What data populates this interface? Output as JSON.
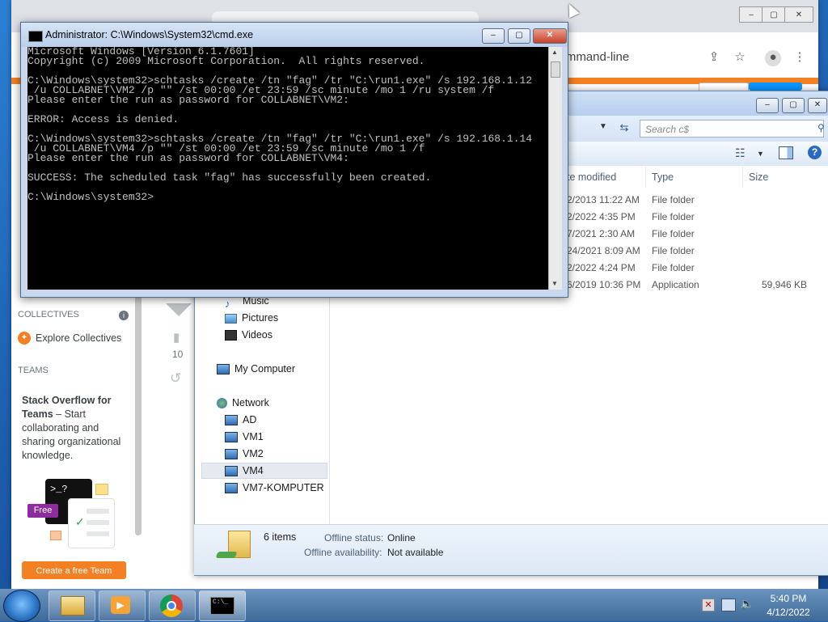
{
  "chrome": {
    "omnibox_text": "command-line",
    "controls": [
      "–",
      "▢",
      "✕"
    ]
  },
  "so": {
    "collectives_label": "COLLECTIVES",
    "explore_collectives": "Explore Collectives",
    "teams_label": "TEAMS",
    "teams_title": "Stack Overflow for Teams",
    "teams_sep": " – ",
    "teams_desc": "Start collaborating and sharing organizational knowledge.",
    "free_badge": "Free",
    "create_team_button": "Create a free Team",
    "vote_count": "10",
    "prompt_glyph": ">_?"
  },
  "explorer": {
    "search_placeholder": "Search c$",
    "columns": {
      "date": "te modified",
      "type": "Type",
      "size": "Size"
    },
    "rows": [
      {
        "date": "2/2013 11:22 AM",
        "type": "File folder",
        "size": ""
      },
      {
        "date": "2/2022 4:35 PM",
        "type": "File folder",
        "size": ""
      },
      {
        "date": "7/2021 2:30 AM",
        "type": "File folder",
        "size": ""
      },
      {
        "date": "24/2021 8:09 AM",
        "type": "File folder",
        "size": ""
      },
      {
        "date": "2/2022 4:24 PM",
        "type": "File folder",
        "size": ""
      },
      {
        "date": "6/2019 10:36 PM",
        "type": "Application",
        "size": "59,946 KB"
      }
    ],
    "nav": {
      "music": "Music",
      "pictures": "Pictures",
      "videos": "Videos",
      "my_computer": "My Computer",
      "network": "Network",
      "hosts": [
        "AD",
        "VM1",
        "VM2",
        "VM4",
        "VM7-KOMPUTER"
      ]
    },
    "details": {
      "count": "6 items",
      "offline_status_label": "Offline status:",
      "offline_status_value": "Online",
      "offline_avail_label": "Offline availability:",
      "offline_avail_value": "Not available"
    }
  },
  "cmd": {
    "title": "Administrator: C:\\Windows\\System32\\cmd.exe",
    "lines": [
      "Microsoft Windows [Version 6.1.7601]",
      "Copyright (c) 2009 Microsoft Corporation.  All rights reserved.",
      "",
      "C:\\Windows\\system32>schtasks /create /tn \"fag\" /tr \"C:\\run1.exe\" /s 192.168.1.12",
      " /u COLLABNET\\VM2 /p \"\" /st 00:00 /et 23:59 /sc minute /mo 1 /ru system /f",
      "Please enter the run as password for COLLABNET\\VM2:",
      "",
      "ERROR: Access is denied.",
      "",
      "C:\\Windows\\system32>schtasks /create /tn \"fag\" /tr \"C:\\run1.exe\" /s 192.168.1.14",
      " /u COLLABNET\\VM4 /p \"\" /st 00:00 /et 23:59 /sc minute /mo 1 /f",
      "Please enter the run as password for COLLABNET\\VM4:",
      "",
      "SUCCESS: The scheduled task \"fag\" has successfully been created.",
      "",
      "C:\\Windows\\system32>"
    ]
  },
  "taskbar": {
    "time": "5:40 PM",
    "date": "4/12/2022"
  },
  "colors": {
    "so_orange": "#f48024",
    "console_bg": "#000000",
    "console_fg": "#c0c0c0"
  }
}
